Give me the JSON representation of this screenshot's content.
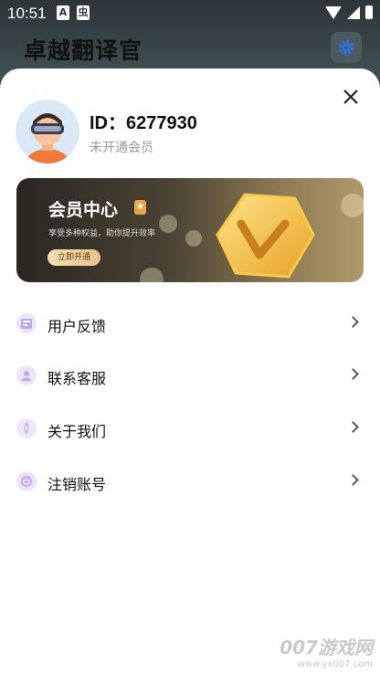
{
  "status_bar": {
    "time": "10:51",
    "left_icons": [
      "A",
      "虫"
    ]
  },
  "app": {
    "title": "卓越翻译官",
    "settings_icon": "gear-icon"
  },
  "profile": {
    "id_text": "ID：6277930",
    "membership_status": "未开通会员",
    "avatar": "vr-headset-avatar"
  },
  "vip_banner": {
    "title": "会员中心",
    "description": "享受多种权益，助你提升效率",
    "button_label": "立即开通"
  },
  "menu": [
    {
      "label": "用户反馈",
      "icon": "feedback-icon",
      "color": "#b9a7f0"
    },
    {
      "label": "联系客服",
      "icon": "customer-service-icon",
      "color": "#b9a7f0"
    },
    {
      "label": "关于我们",
      "icon": "info-icon",
      "color": "#c9b1f2"
    },
    {
      "label": "注销账号",
      "icon": "power-icon",
      "color": "#c2a9f3"
    }
  ],
  "watermark": {
    "big": "007游戏网",
    "small": "www.yx007.com"
  },
  "colors": {
    "accent": "#3b5b9b",
    "menu_icon": "#b9a7f0"
  }
}
